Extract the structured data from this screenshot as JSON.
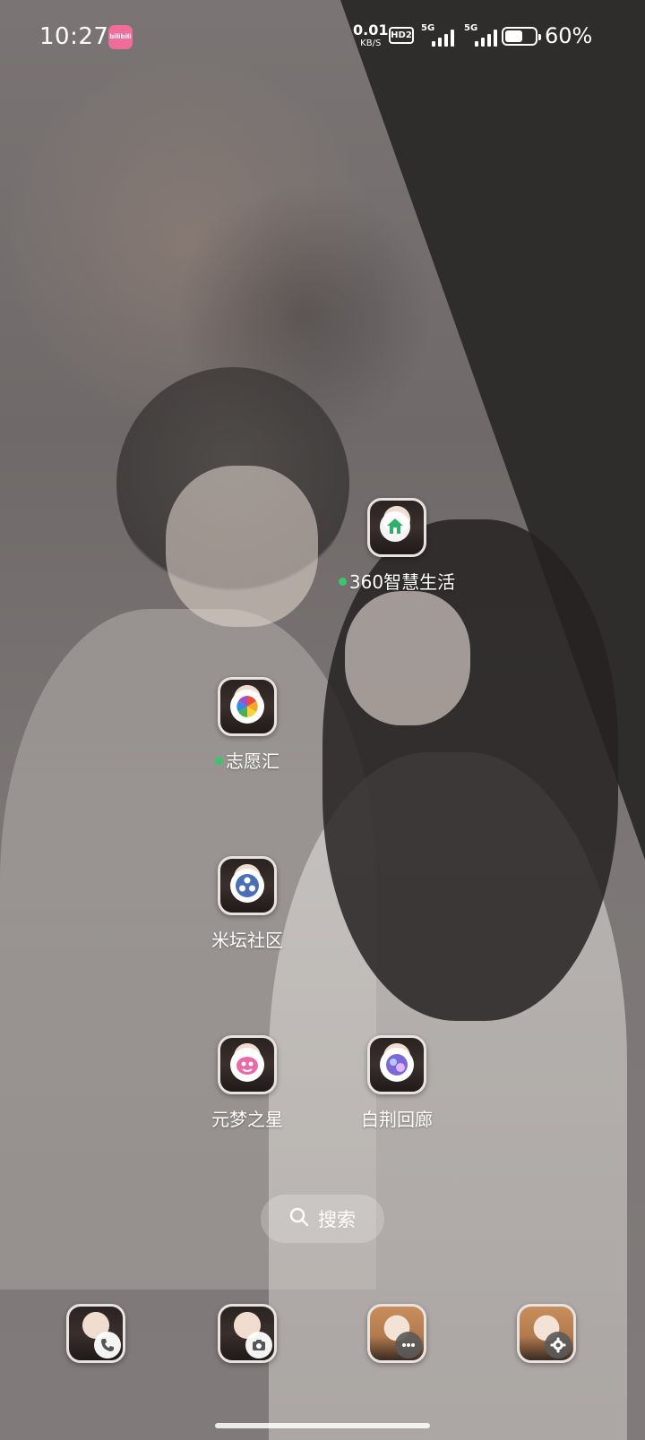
{
  "status_bar": {
    "time": "10:27",
    "notification_app_text": "bilibili",
    "net_speed_value": "0.01",
    "net_speed_unit": "KB/S",
    "hd_label": "HD2",
    "sim1_label": "5G",
    "sim2_label": "5G",
    "battery_percent": "60%",
    "battery_level": 0.6
  },
  "apps": [
    {
      "label": "360智慧生活",
      "has_dot": true,
      "badge_icon": "home-icon",
      "badge_color": "#2fb06a"
    },
    {
      "label": "志愿汇",
      "has_dot": true,
      "badge_icon": "pinwheel-icon",
      "badge_color": "#e94b3c"
    },
    {
      "label": "米坛社区",
      "has_dot": false,
      "badge_icon": "community-icon",
      "badge_color": "#4a6fb5"
    },
    {
      "label": "元梦之星",
      "has_dot": false,
      "badge_icon": "game-icon",
      "badge_color": "#e86aa8"
    },
    {
      "label": "白荆回廊",
      "has_dot": false,
      "badge_icon": "game-icon",
      "badge_color": "#7a69d6"
    }
  ],
  "search": {
    "label": "搜索"
  },
  "dock": [
    {
      "name": "phone",
      "icon": "phone-icon"
    },
    {
      "name": "camera",
      "icon": "camera-icon"
    },
    {
      "name": "messages",
      "icon": "message-icon"
    },
    {
      "name": "settings",
      "icon": "gear-icon"
    }
  ],
  "colors": {
    "dot_green": "#3ec46d",
    "wallpaper_dark": "#2f2c2c"
  }
}
